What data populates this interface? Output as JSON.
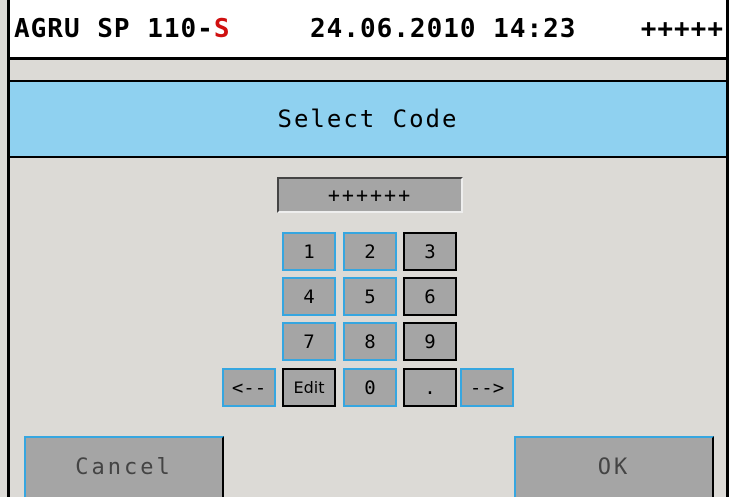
{
  "header": {
    "model": "AGRU SP 110-",
    "model_suffix": "S",
    "datetime": "24.06.2010 14:23",
    "status": "+++++"
  },
  "dialog": {
    "title": "Select Code",
    "code_value": "++++++"
  },
  "keypad": {
    "keys": [
      "1",
      "2",
      "3",
      "4",
      "5",
      "6",
      "7",
      "8",
      "9",
      "<--",
      "Edit",
      "0",
      ".",
      "-->"
    ]
  },
  "footer": {
    "cancel_label": "Cancel",
    "ok_label": "OK"
  },
  "colors": {
    "title_bar": "#8fd1f0",
    "background": "#dcdad6",
    "button": "#a5a5a5",
    "focus_border": "#36a6e0",
    "model_suffix": "#d01010"
  }
}
